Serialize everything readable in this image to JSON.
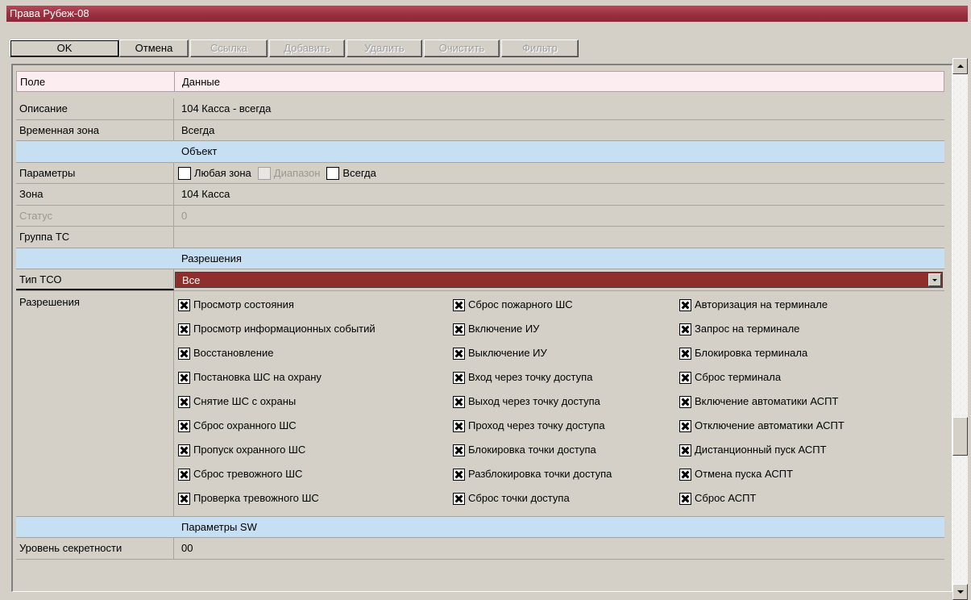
{
  "window": {
    "title": "Права Рубеж-08"
  },
  "toolbar": {
    "ok": "OK",
    "cancel": "Отмена",
    "link": "Ссылка",
    "add": "Добавить",
    "delete": "Удалить",
    "clear": "Очистить",
    "filter": "Фильтр"
  },
  "grid": {
    "header": {
      "field": "Поле",
      "data": "Данные"
    },
    "description": {
      "label": "Описание",
      "value": "104 Касса - всегда"
    },
    "time_zone": {
      "label": "Временная зона",
      "value": "Всегда"
    },
    "section_object": "Объект",
    "params": {
      "label": "Параметры",
      "any_zone": "Любая зона",
      "range": "Диапазон",
      "always": "Всегда"
    },
    "zone": {
      "label": "Зона",
      "value": "104 Касса"
    },
    "status": {
      "label": "Статус",
      "value": "0"
    },
    "tc_group": {
      "label": "Группа ТС",
      "value": ""
    },
    "section_permissions": "Разрешения",
    "tso_type": {
      "label": "Тип ТСО",
      "value": "Все"
    },
    "permissions": {
      "label": "Разрешения",
      "col1": [
        "Просмотр состояния",
        "Просмотр информационных событий",
        "Восстановление",
        "Постановка ШС на охрану",
        "Снятие ШС с охраны",
        "Сброс охранного ШС",
        "Пропуск охранного ШС",
        "Сброс тревожного ШС",
        "Проверка тревожного ШС"
      ],
      "col2": [
        "Сброс пожарного ШС",
        "Включение ИУ",
        "Выключение ИУ",
        "Вход через точку доступа",
        "Выход через точку доступа",
        "Проход через точку доступа",
        "Блокировка точки доступа",
        "Разблокировка точки доступа",
        "Сброс точки доступа"
      ],
      "col3": [
        "Авторизация на терминале",
        "Запрос на терминале",
        "Блокировка терминала",
        "Сброс терминала",
        "Включение автоматики АСПТ",
        "Отключение автоматики АСПТ",
        "Дистанционный пуск АСПТ",
        "Отмена пуска АСПТ",
        "Сброс АСПТ"
      ]
    },
    "section_sw": "Параметры SW",
    "secrecy": {
      "label": "Уровень секретности",
      "value": "00"
    }
  },
  "colors": {
    "title_bar": "#9a2f40",
    "section_band": "#c6dff3",
    "header_band": "#fceef0",
    "combo_selected": "#8f2f2d"
  }
}
